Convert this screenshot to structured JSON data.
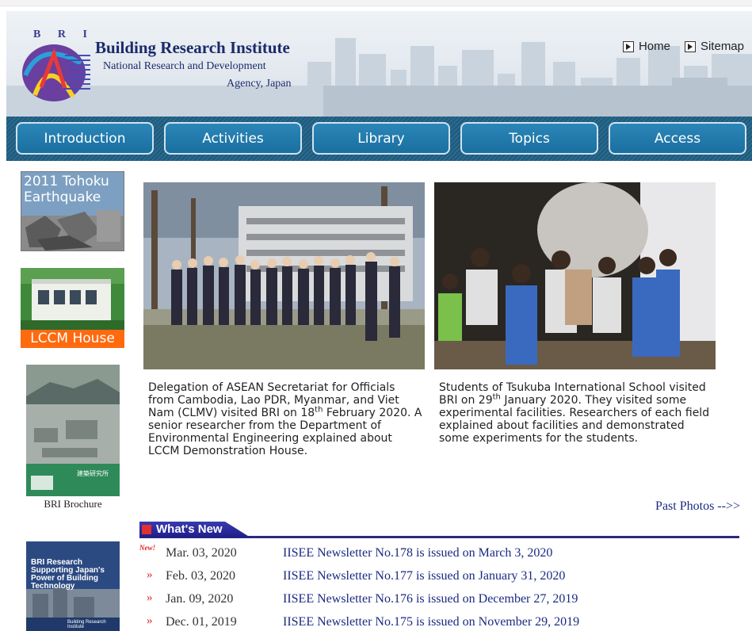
{
  "header": {
    "logo_letters": "B R I",
    "org_name": "Building Research Institute",
    "org_sub1": "National Research and Development",
    "org_sub2": "Agency, Japan",
    "links": [
      {
        "label": "Home"
      },
      {
        "label": "Sitemap"
      }
    ]
  },
  "nav": {
    "items": [
      {
        "label": "Introduction"
      },
      {
        "label": "Activities"
      },
      {
        "label": "Library"
      },
      {
        "label": "Topics"
      },
      {
        "label": "Access"
      }
    ]
  },
  "sidebar": {
    "tohoku": "2011 Tohoku Earthquake",
    "tohoku_line1": "2011 Tohoku",
    "tohoku_line2": "Earthquake",
    "lccm": "LCCM House",
    "brochure_caption": "BRI Brochure",
    "brochure_org": "建築研究所",
    "power_line1": "BRI Research",
    "power_line2": "Supporting Japan's",
    "power_line3": "Power of Building",
    "power_line4": "Technology",
    "power_org": "Building Research Institute"
  },
  "photos": {
    "caption1_pre": "Delegation of ASEAN Secretariat for Officials from Cambodia, Lao PDR, Myanmar, and Viet Nam (CLMV) visited BRI on 18",
    "caption1_sup": "th",
    "caption1_post": " February 2020. A senior researcher from the Department of Environmental Engineering explained about LCCM Demonstration House.",
    "caption2_pre": "Students of Tsukuba International School visited BRI on 29",
    "caption2_sup": "th",
    "caption2_post": " January 2020. They visited some experimental facilities. Researchers of each field explained about facilities and demonstrated some experiments for the students.",
    "past_photos": "Past Photos -->>"
  },
  "whats_new": {
    "title": "What's New",
    "new_marker": "New!",
    "bullet": "»",
    "items": [
      {
        "date": "Mar. 03, 2020",
        "text": "IISEE Newsletter No.178 is issued on March 3, 2020"
      },
      {
        "date": "Feb. 03, 2020",
        "text": "IISEE Newsletter No.177 is issued on January 31, 2020"
      },
      {
        "date": "Jan. 09, 2020",
        "text": "IISEE Newsletter No.176 is issued on December 27, 2019"
      },
      {
        "date": "Dec. 01, 2019",
        "text": "IISEE Newsletter No.175 is issued on November 29, 2019"
      }
    ]
  },
  "colors": {
    "brand_navy": "#1a2a6a",
    "nav_button": "#1a6fa0",
    "accent_orange": "#ff6a10",
    "link_blue": "#1a2a80",
    "new_red": "#e02020"
  }
}
